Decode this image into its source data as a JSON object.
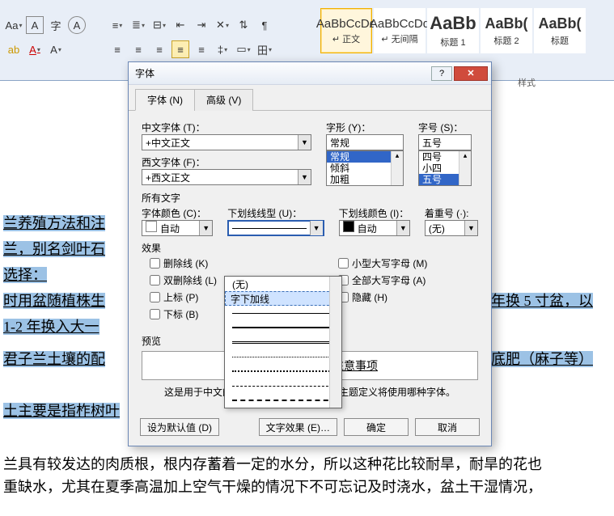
{
  "ribbon": {
    "styles": [
      {
        "sample": "AaBbCcDd",
        "label": "↵ 正文",
        "big": false
      },
      {
        "sample": "AaBbCcDd",
        "label": "↵ 无间隔",
        "big": false
      },
      {
        "sample": "AaBb",
        "label": "标题 1",
        "big": true
      },
      {
        "sample": "AaBb(",
        "label": "标题 2",
        "big": false,
        "h1": true
      },
      {
        "sample": "AaBb(",
        "label": "标题",
        "big": false,
        "h1": true
      }
    ],
    "group_label": "样式"
  },
  "dialog": {
    "title": "字体",
    "tabs": {
      "font": "字体 (N)",
      "adv": "高级 (V)"
    },
    "labels": {
      "cn_font": "中文字体 (T)：",
      "west_font": "西文字体 (F)：",
      "style": "字形 (Y)：",
      "size": "字号 (S)：",
      "all_text": "所有文字",
      "font_color": "字体颜色 (C)：",
      "ul_style": "下划线线型 (U)：",
      "ul_color": "下划线颜色 (I)：",
      "emphasis": "着重号 (·):",
      "effects": "效果",
      "preview": "预览"
    },
    "values": {
      "cn_font": "+中文正文",
      "west_font": "+西文正文",
      "style_input": "常规",
      "style_list": [
        "常规",
        "倾斜",
        "加粗"
      ],
      "size_input": "五号",
      "size_list": [
        "四号",
        "小四",
        "五号"
      ],
      "font_color": "自动",
      "ul_color": "自动",
      "emphasis": "(无)"
    },
    "underline_popup": {
      "none": "(无)",
      "words": "字下加线"
    },
    "checks_left": [
      "删除线 (K)",
      "双删除线 (L)",
      "上标 (P)",
      "下标 (B)"
    ],
    "checks_right": [
      "小型大写字母 (M)",
      "全部大写字母 (A)",
      "隐藏 (H)"
    ],
    "preview_text": "君子兰养殖方法和注意事项",
    "preview_note": "这是用于中文的正文主题字体。当前文档主题定义将使用哪种字体。",
    "buttons": {
      "default": "设为默认值 (D)",
      "text_effects": "文字效果 (E)…",
      "ok": "确定",
      "cancel": "取消"
    }
  },
  "doc": {
    "l1": "兰养殖方法和注",
    "l2": "兰，别名剑叶石",
    "l3": "选择：",
    "l4a": "时用盆随植株生",
    "l4b": "二年换 5 寸盆，以",
    "l5": "1-2 年换入大一",
    "l6a": "君子兰土壤的配",
    "l6b": "份底肥（麻子等）",
    "l7": "土主要是指柞树叶",
    "p1": "兰具有较发达的肉质根，根内存蓄着一定的水分，所以这种花比较耐旱，耐旱的花也",
    "p2": "重缺水，尤其在夏季高温加上空气干燥的情况下不可忘记及时浇水，盆土干湿情况，"
  }
}
